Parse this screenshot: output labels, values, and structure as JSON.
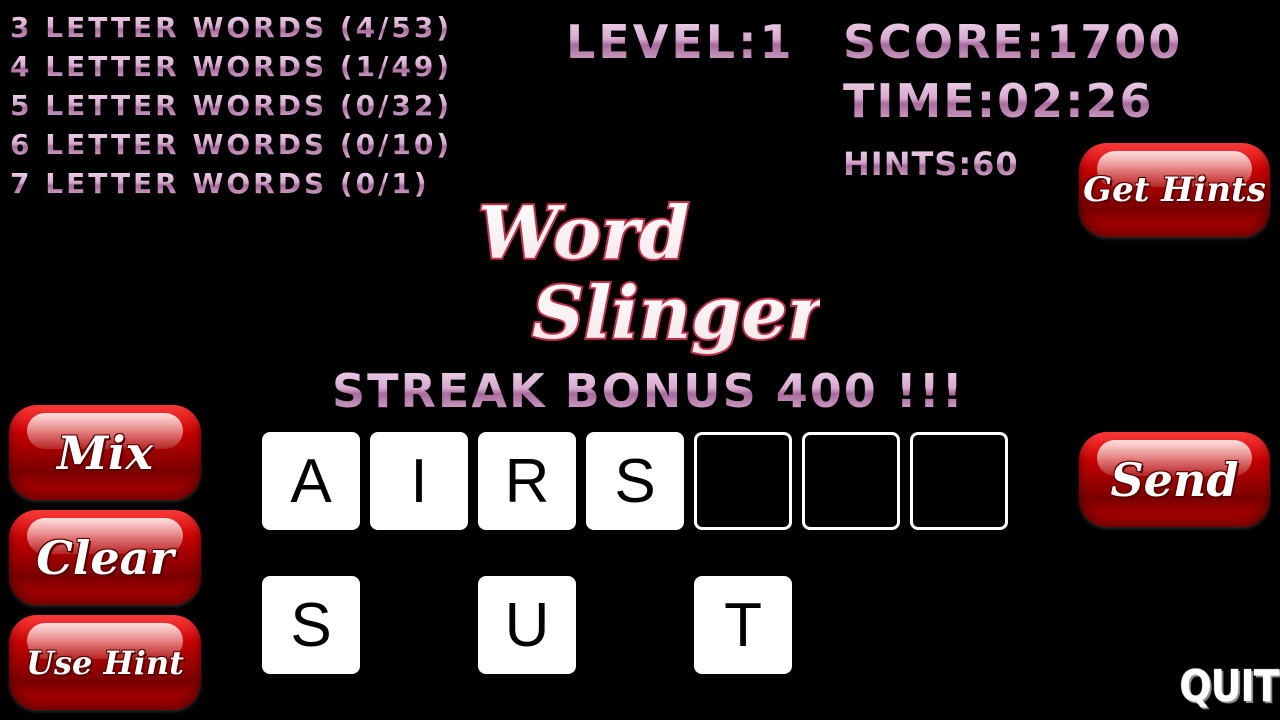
{
  "word_counts": [
    {
      "text": "3 LETTER WORDS (4/53)"
    },
    {
      "text": "4 LETTER WORDS (1/49)"
    },
    {
      "text": "5 LETTER WORDS (0/32)"
    },
    {
      "text": "6 LETTER WORDS (0/10)"
    },
    {
      "text": "7 LETTER WORDS (0/1)"
    }
  ],
  "header": {
    "level": "LEVEL:1",
    "score": "SCORE:1700",
    "time": "TIME:02:26",
    "hints": "HINTS:60"
  },
  "logo": {
    "line1": "Word",
    "line2": "Slinger"
  },
  "message": "STREAK BONUS 400 !!!",
  "buttons": {
    "get_hints": "Get Hints",
    "mix": "Mix",
    "clear": "Clear",
    "use_hint": "Use Hint",
    "send": "Send",
    "quit": "QUIT"
  },
  "answer_slots": [
    "A",
    "I",
    "R",
    "S",
    "",
    "",
    ""
  ],
  "letter_pool": [
    "S",
    "U",
    "T"
  ],
  "colors": {
    "button_red": "#c40000",
    "text_pink": "#d7a9cf",
    "logo_outline": "#c0304a"
  }
}
